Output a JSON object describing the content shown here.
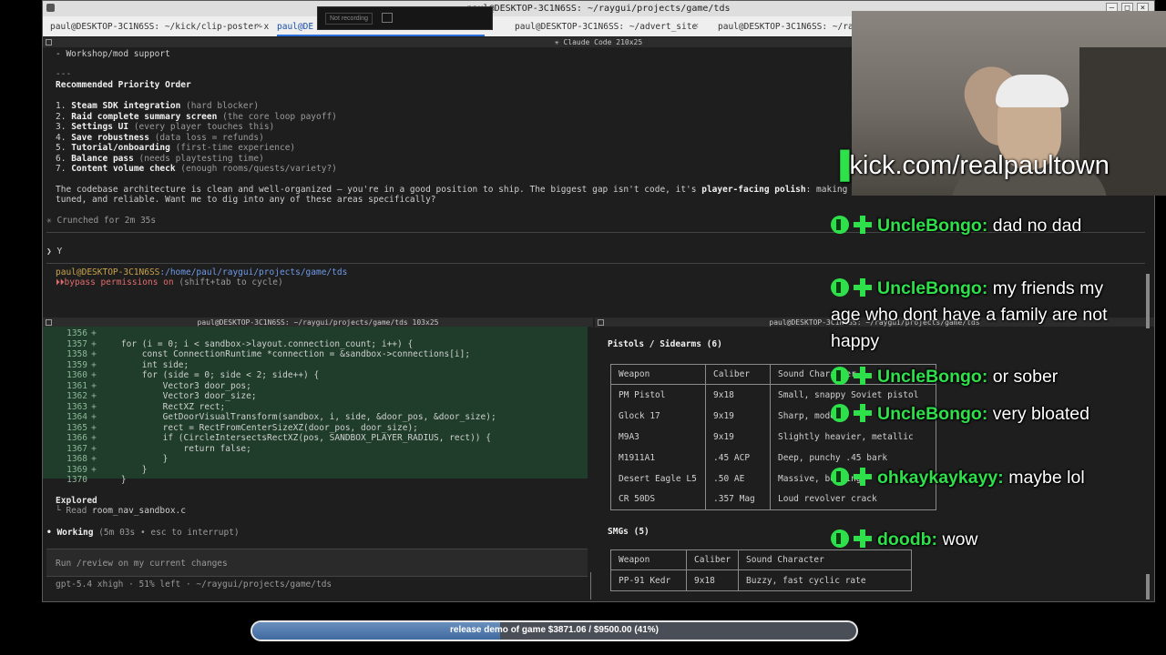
{
  "window": {
    "title": "paul@DESKTOP-3C1N6SS: ~/raygui/projects/game/tds",
    "tabs": [
      {
        "label": "paul@DESKTOP-3C1N6SS: ~/kick/clip-poster-x"
      },
      {
        "label": "paul@DE"
      },
      {
        "label": "paul@DESKTOP-3C1N6SS: ~/advert_site"
      },
      {
        "label": "paul@DESKTOP-3C1N6SS: ~/raygui"
      }
    ],
    "overlay": {
      "recording_label": "Not recording"
    }
  },
  "top_pane": {
    "header": "✳ Claude Code 210x25",
    "lines": {
      "workshop": "- Workshop/mod support",
      "rule": "---",
      "heading": "Recommended Priority Order",
      "explanation_1a": "The codebase architecture is clean and well-organized — you're in a good position to ship. The biggest gap isn't code, it's ",
      "explanation_1b": "player-facing polish",
      "explanation_1c": ": making",
      "explanation_2": "tuned, and reliable. Want me to dig into any of these areas specifically?",
      "crunched": "✳ Crunched for 2m 35s",
      "prompt_input": "❯ Y",
      "user_host": "paul@DESKTOP-3C1N6SS",
      "cwd": ":/home/paul/raygui/projects/game/tds",
      "bypass_marker": "⏵⏵",
      "bypass": "bypass permissions on",
      "bypass_hint": " (shift+tab to cycle)"
    },
    "priorities": [
      {
        "n": "1.",
        "title": "Steam SDK integration",
        "note": " (hard blocker)"
      },
      {
        "n": "2.",
        "title": "Raid complete summary screen",
        "note": " (the core loop payoff)"
      },
      {
        "n": "3.",
        "title": "Settings UI",
        "note": " (every player touches this)"
      },
      {
        "n": "4.",
        "title": "Save robustness",
        "note": " (data loss = refunds)"
      },
      {
        "n": "5.",
        "title": "Tutorial/onboarding",
        "note": " (first-time experience)"
      },
      {
        "n": "6.",
        "title": "Balance pass",
        "note": " (needs playtesting time)"
      },
      {
        "n": "7.",
        "title": "Content volume check",
        "note": " (enough rooms/quests/variety?)"
      }
    ]
  },
  "bottom_left_pane": {
    "header": "paul@DESKTOP-3C1N6SS: ~/raygui/projects/game/tds 103x25",
    "diff_lines": [
      {
        "num": "1356",
        "sign": "+",
        "code": ""
      },
      {
        "num": "1357",
        "sign": "+",
        "code": "    for (i = 0; i < sandbox->layout.connection_count; i++) {"
      },
      {
        "num": "1358",
        "sign": "+",
        "code": "        const ConnectionRuntime *connection = &sandbox->connections[i];"
      },
      {
        "num": "1359",
        "sign": "+",
        "code": "        int side;"
      },
      {
        "num": "1360",
        "sign": "+",
        "code": "        for (side = 0; side < 2; side++) {"
      },
      {
        "num": "1361",
        "sign": "+",
        "code": "            Vector3 door_pos;"
      },
      {
        "num": "1362",
        "sign": "+",
        "code": "            Vector3 door_size;"
      },
      {
        "num": "1363",
        "sign": "+",
        "code": "            RectXZ rect;"
      },
      {
        "num": "1364",
        "sign": "+",
        "code": "            GetDoorVisualTransform(sandbox, i, side, &door_pos, &door_size);"
      },
      {
        "num": "1365",
        "sign": "+",
        "code": "            rect = RectFromCenterSizeXZ(door_pos, door_size);"
      },
      {
        "num": "1366",
        "sign": "+",
        "code": "            if (CircleIntersectsRectXZ(pos, SANDBOX_PLAYER_RADIUS, rect)) {"
      },
      {
        "num": "1367",
        "sign": "+",
        "code": "                return false;"
      },
      {
        "num": "1368",
        "sign": "+",
        "code": "            }"
      },
      {
        "num": "1369",
        "sign": "+",
        "code": "        }"
      },
      {
        "num": "1370",
        "sign": " ",
        "code": "    }"
      }
    ],
    "explored": "Explored",
    "read_label": "└ Read",
    "read_file": " room_nav_sandbox.c",
    "working": "• Working",
    "working_status": " (5m 03s • esc to interrupt)",
    "input_placeholder": "Run /review on my current changes",
    "status_line": "gpt-5.4 xhigh · 51% left · ~/raygui/projects/game/tds"
  },
  "bottom_right_pane": {
    "header": "paul@DESKTOP-3C1N6SS: ~/raygui/projects/game/tds",
    "pistols": {
      "title": "Pistols / Sidearms (6)",
      "columns": [
        "Weapon",
        "Caliber",
        "Sound Character"
      ],
      "rows": [
        [
          "PM Pistol",
          "9x18",
          "Small, snappy Soviet pistol"
        ],
        [
          "Glock 17",
          "9x19",
          "Sharp, modern"
        ],
        [
          "M9A3",
          "9x19",
          "Slightly heavier, metallic"
        ],
        [
          "M1911A1",
          ".45 ACP",
          "Deep, punchy .45 bark"
        ],
        [
          "Desert Eagle L5",
          ".50 AE",
          "Massive, booming"
        ],
        [
          "CR 50DS",
          ".357 Mag",
          "Loud revolver crack"
        ]
      ]
    },
    "smgs": {
      "title": "SMGs (5)",
      "columns": [
        "Weapon",
        "Caliber",
        "Sound Character"
      ],
      "rows": [
        [
          "PP-91 Kedr",
          "9x18",
          "Buzzy, fast cyclic rate"
        ]
      ]
    }
  },
  "stream": {
    "kick_url": "kick.com/realpaultown",
    "chat": [
      {
        "user": "UncleBongo:",
        "msg": " dad no dad"
      },
      {
        "user": "UncleBongo:",
        "msg": " my friends my age who dont have a family are not happy"
      },
      {
        "user": "UncleBongo:",
        "msg": " or sober"
      },
      {
        "user": "UncleBongo:",
        "msg": " very bloated"
      },
      {
        "user": "ohkaykaykayy:",
        "msg": " maybe lol"
      },
      {
        "user": "doodb:",
        "msg": " wow"
      }
    ],
    "goal": {
      "text": "release demo of game $3871.06 / $9500.00 (41%)",
      "progress": 0.41
    }
  },
  "colors": {
    "accent_green": "#2ee04a",
    "diff_bg": "#1f3d2a",
    "path_blue": "#6f9be8"
  }
}
